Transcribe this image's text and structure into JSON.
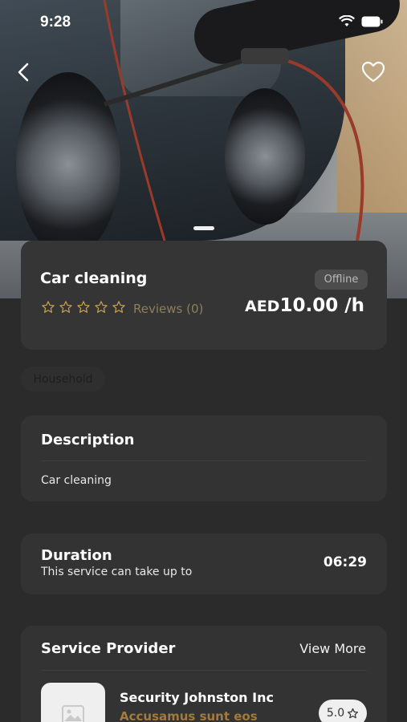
{
  "status_bar": {
    "time": "9:28"
  },
  "service": {
    "title": "Car cleaning",
    "status": "Offline",
    "rating_stars": 0,
    "reviews_label": "Reviews (0)",
    "price_currency": "AED",
    "price_amount": "10.00 /h",
    "category": "Household"
  },
  "description": {
    "title": "Description",
    "text": "Car cleaning"
  },
  "duration": {
    "title": "Duration",
    "subtitle": "This service can take up to",
    "value": "06:29"
  },
  "provider": {
    "section_title": "Service Provider",
    "view_more": "View More",
    "name": "Security Johnston Inc",
    "subtitle": "Accusamus sunt eos",
    "rating": "5.0"
  },
  "icons": {
    "back": "chevron-left-icon",
    "favorite": "heart-outline-icon",
    "star": "star-outline-icon",
    "avatar": "image-placeholder-icon"
  },
  "colors": {
    "background": "#2b2b2b",
    "card": "#333333",
    "accent_gold": "#a27a3c",
    "star": "#c8a154"
  }
}
